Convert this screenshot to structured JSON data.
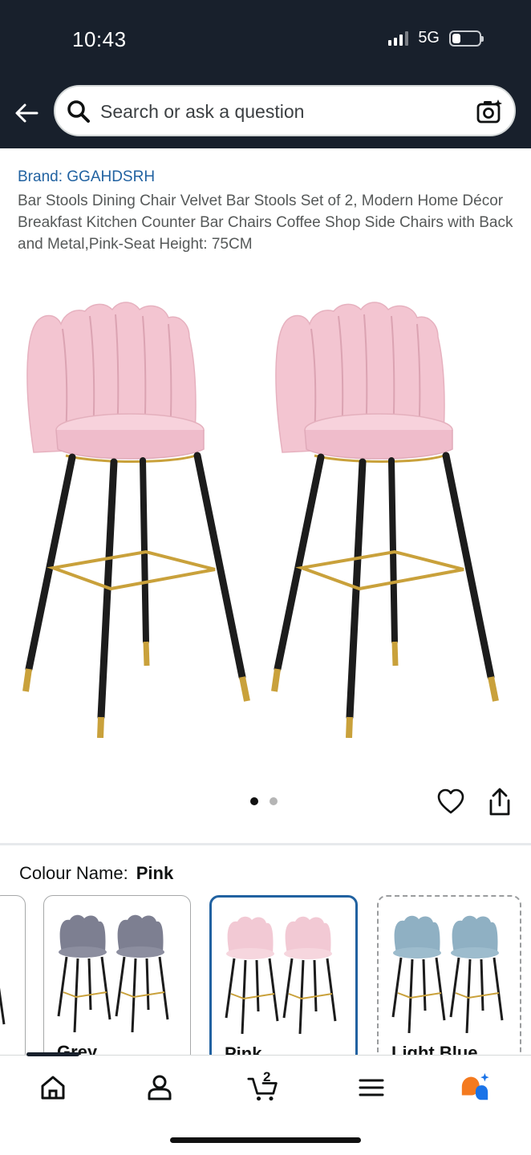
{
  "status_bar": {
    "time": "10:43",
    "network": "5G"
  },
  "search": {
    "placeholder": "Search or ask a question"
  },
  "product": {
    "brand": "Brand: GGAHDSRH",
    "title": "Bar Stools Dining Chair Velvet Bar Stools Set of 2, Modern Home Décor Breakfast Kitchen Counter Bar Chairs Coffee Shop Side Chairs with Back and Metal,Pink-Seat Height: 75CM",
    "image_count": 2,
    "active_image": 1
  },
  "colour": {
    "label": "Colour Name:",
    "selected": "Pink",
    "options": [
      {
        "label": "",
        "color": "#e8b9c7"
      },
      {
        "label": "Grey",
        "color": "#7d7f91"
      },
      {
        "label": "Pink",
        "color": "#f2c9d4"
      },
      {
        "label": "Light Blue",
        "color": "#8fb0c3"
      }
    ]
  },
  "bottom_nav": {
    "items": [
      "home-icon",
      "account-icon",
      "cart-icon",
      "menu-icon",
      "rufus-icon"
    ],
    "cart_count": "2"
  },
  "colors": {
    "header_bg": "#18202c",
    "brand_link": "#2162a1",
    "stool_pink": "#f4c6d2",
    "leg_black": "#1c1c1c",
    "gold": "#c9a13b"
  }
}
